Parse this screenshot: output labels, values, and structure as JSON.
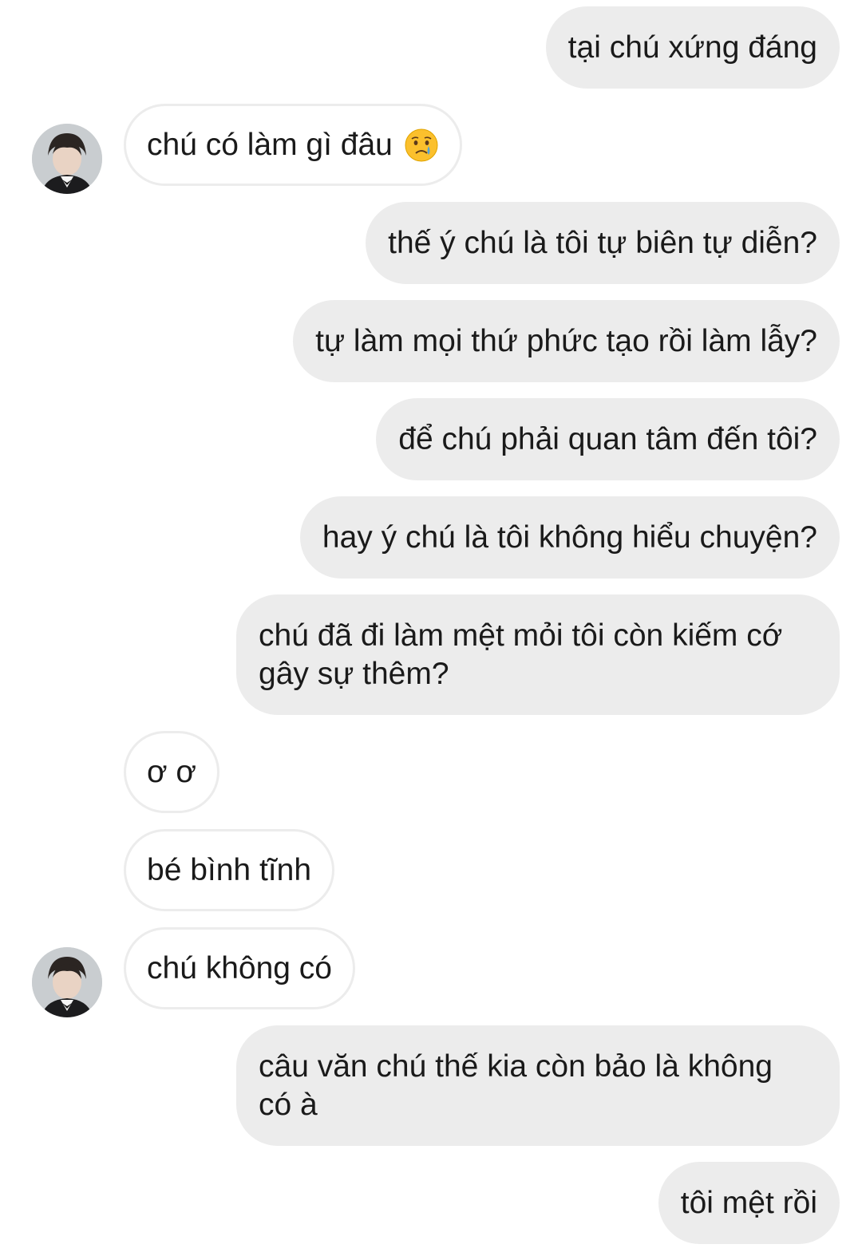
{
  "messages": [
    {
      "side": "sent",
      "text": "tại chú xứng đáng"
    },
    {
      "side": "recv",
      "text": "chú có làm gì đâu",
      "emoji": "crying-face-icon",
      "avatar": true
    },
    {
      "side": "sent",
      "text": "thế ý chú là tôi tự biên tự diễn?"
    },
    {
      "side": "sent",
      "text": "tự làm mọi thứ phức tạo rồi làm lẫy?"
    },
    {
      "side": "sent",
      "text": "để chú phải quan tâm đến tôi?"
    },
    {
      "side": "sent",
      "text": "hay ý chú là tôi không hiểu chuyện?"
    },
    {
      "side": "sent",
      "line1": "chú đã đi làm mệt mỏi tôi còn kiếm cớ",
      "line2": "gây sự thêm?"
    },
    {
      "side": "recv",
      "text": "ơ ơ"
    },
    {
      "side": "recv",
      "text": "bé bình tĩnh"
    },
    {
      "side": "recv",
      "text": "chú không có",
      "avatar": true
    },
    {
      "side": "sent",
      "line1": "câu văn chú thế kia còn bảo là không",
      "line2": "có à"
    },
    {
      "side": "sent",
      "text": "tôi mệt rồi"
    }
  ],
  "colors": {
    "sent_bubble": "#ececec",
    "recv_border": "#ececec",
    "text": "#1a1a1a"
  }
}
